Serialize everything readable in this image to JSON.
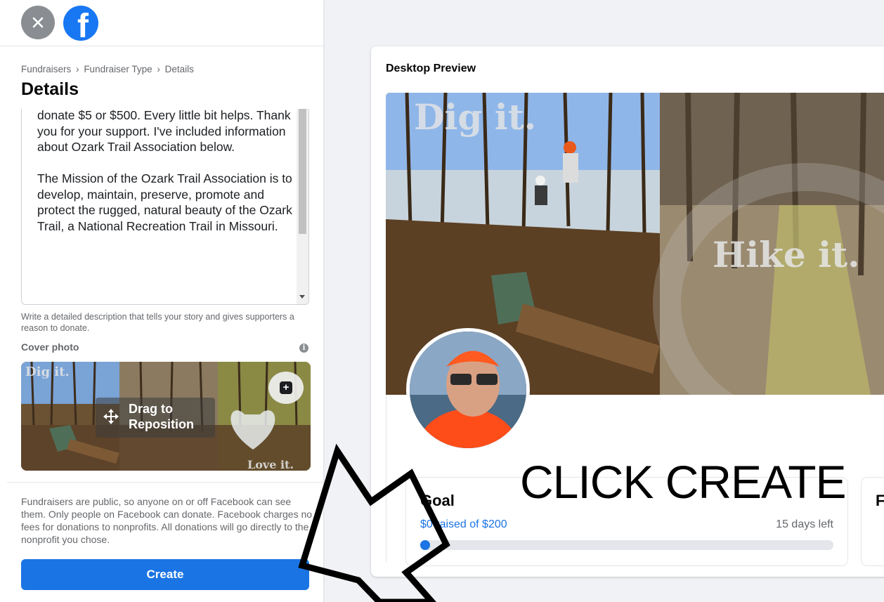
{
  "header": {
    "close_icon": "close-icon",
    "logo_icon": "facebook-logo-icon",
    "logo_letter": "f"
  },
  "breadcrumb": {
    "items": [
      "Fundraisers",
      "Fundraiser Type",
      "Details"
    ],
    "separator": "›"
  },
  "page_title": "Details",
  "description": {
    "value": "donate $5 or $500. Every little bit helps. Thank you for your support. I've included information about Ozark Trail Association below.\n\nThe Mission of the Ozark Trail Association is to develop, maintain, preserve, promote and protect the rugged, natural beauty of the Ozark Trail, a National Recreation Trail in Missouri.",
    "help": "Write a detailed description that tells your story and gives supporters a reason to donate."
  },
  "cover_photo": {
    "label": "Cover photo",
    "info_icon": "info-icon",
    "info_glyph": "i",
    "drag_label": "Drag to Reposition",
    "add_icon": "add-photo-icon",
    "add_glyph": "+",
    "image_text_top": "Dig it.",
    "image_text_bottom": "Love it."
  },
  "public_note": "Fundraisers are public, so anyone on or off Facebook can see them. Only people on Facebook can donate. Facebook charges no fees for donations to nonprofits. All donations will go directly to the nonprofit you chose.",
  "create_button": "Create",
  "preview": {
    "title": "Desktop Preview",
    "cover_text_1": "Dig it.",
    "cover_text_2": "Hike it.",
    "goal_label": "Goal",
    "raised": "$0 raised of $200",
    "days_left": "15 days left",
    "progress_fraction": 0,
    "second_card_initial": "F"
  },
  "annotation": {
    "text": "CLICK CREATE"
  },
  "colors": {
    "accent": "#1b74e4",
    "facebook_blue": "#1877f2",
    "page_bg": "#f0f2f5"
  }
}
